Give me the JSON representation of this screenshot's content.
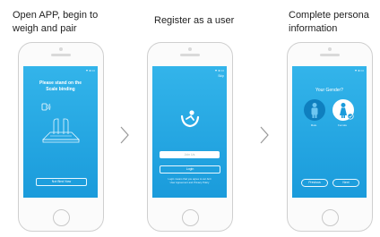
{
  "captions": {
    "step1_line1": "Open APP, begin to",
    "step1_line2": "weigh and pair",
    "step2": "Register as a user",
    "step3_line1": "Complete persona",
    "step3_line2": "information"
  },
  "phone1": {
    "instruction_line1": "Please stand on the",
    "instruction_line2": "Scale binding",
    "button": "Not Bind Now",
    "icons": [
      "bluetooth-icon",
      "scale-icon"
    ]
  },
  "phone2": {
    "skip": "Skip",
    "join_field": "Join Us",
    "login_button": "Login",
    "terms_line1": "Login means that you agree to our Anti",
    "terms_line2": "User Agreement and Privacy Policy",
    "icons": [
      "app-logo-icon"
    ]
  },
  "phone3": {
    "title": "Your Gender?",
    "male_label": "Male",
    "female_label": "Female",
    "previous_button": "Previous",
    "next_button": "Next",
    "icons": [
      "male-icon",
      "female-icon",
      "check-icon"
    ]
  },
  "colors": {
    "screen": "#1fa6e2",
    "frame": "#cfcfcf",
    "text_dark": "#222222"
  }
}
